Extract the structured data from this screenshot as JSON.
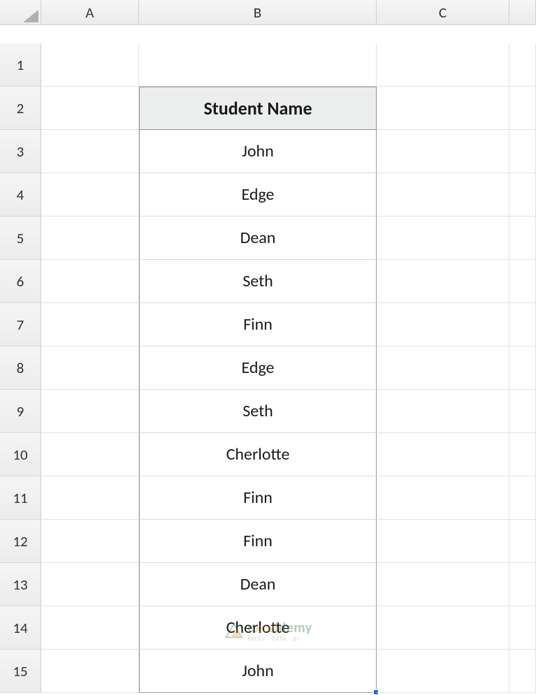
{
  "columns": [
    "A",
    "B",
    "C",
    ""
  ],
  "rows": [
    "1",
    "2",
    "3",
    "4",
    "5",
    "6",
    "7",
    "8",
    "9",
    "10",
    "11",
    "12",
    "13",
    "14",
    "15"
  ],
  "table": {
    "header": "Student Name",
    "data": [
      "John",
      "Edge",
      "Dean",
      "Seth",
      "Finn",
      "Edge",
      "Seth",
      "Cherlotte",
      "Finn",
      "Finn",
      "Dean",
      "Cherlotte",
      "John"
    ]
  },
  "watermark": {
    "title_part1": "e",
    "title_part2": "xcel",
    "title_part3": "demy",
    "sub": "EXCEL · DATA · BI"
  }
}
